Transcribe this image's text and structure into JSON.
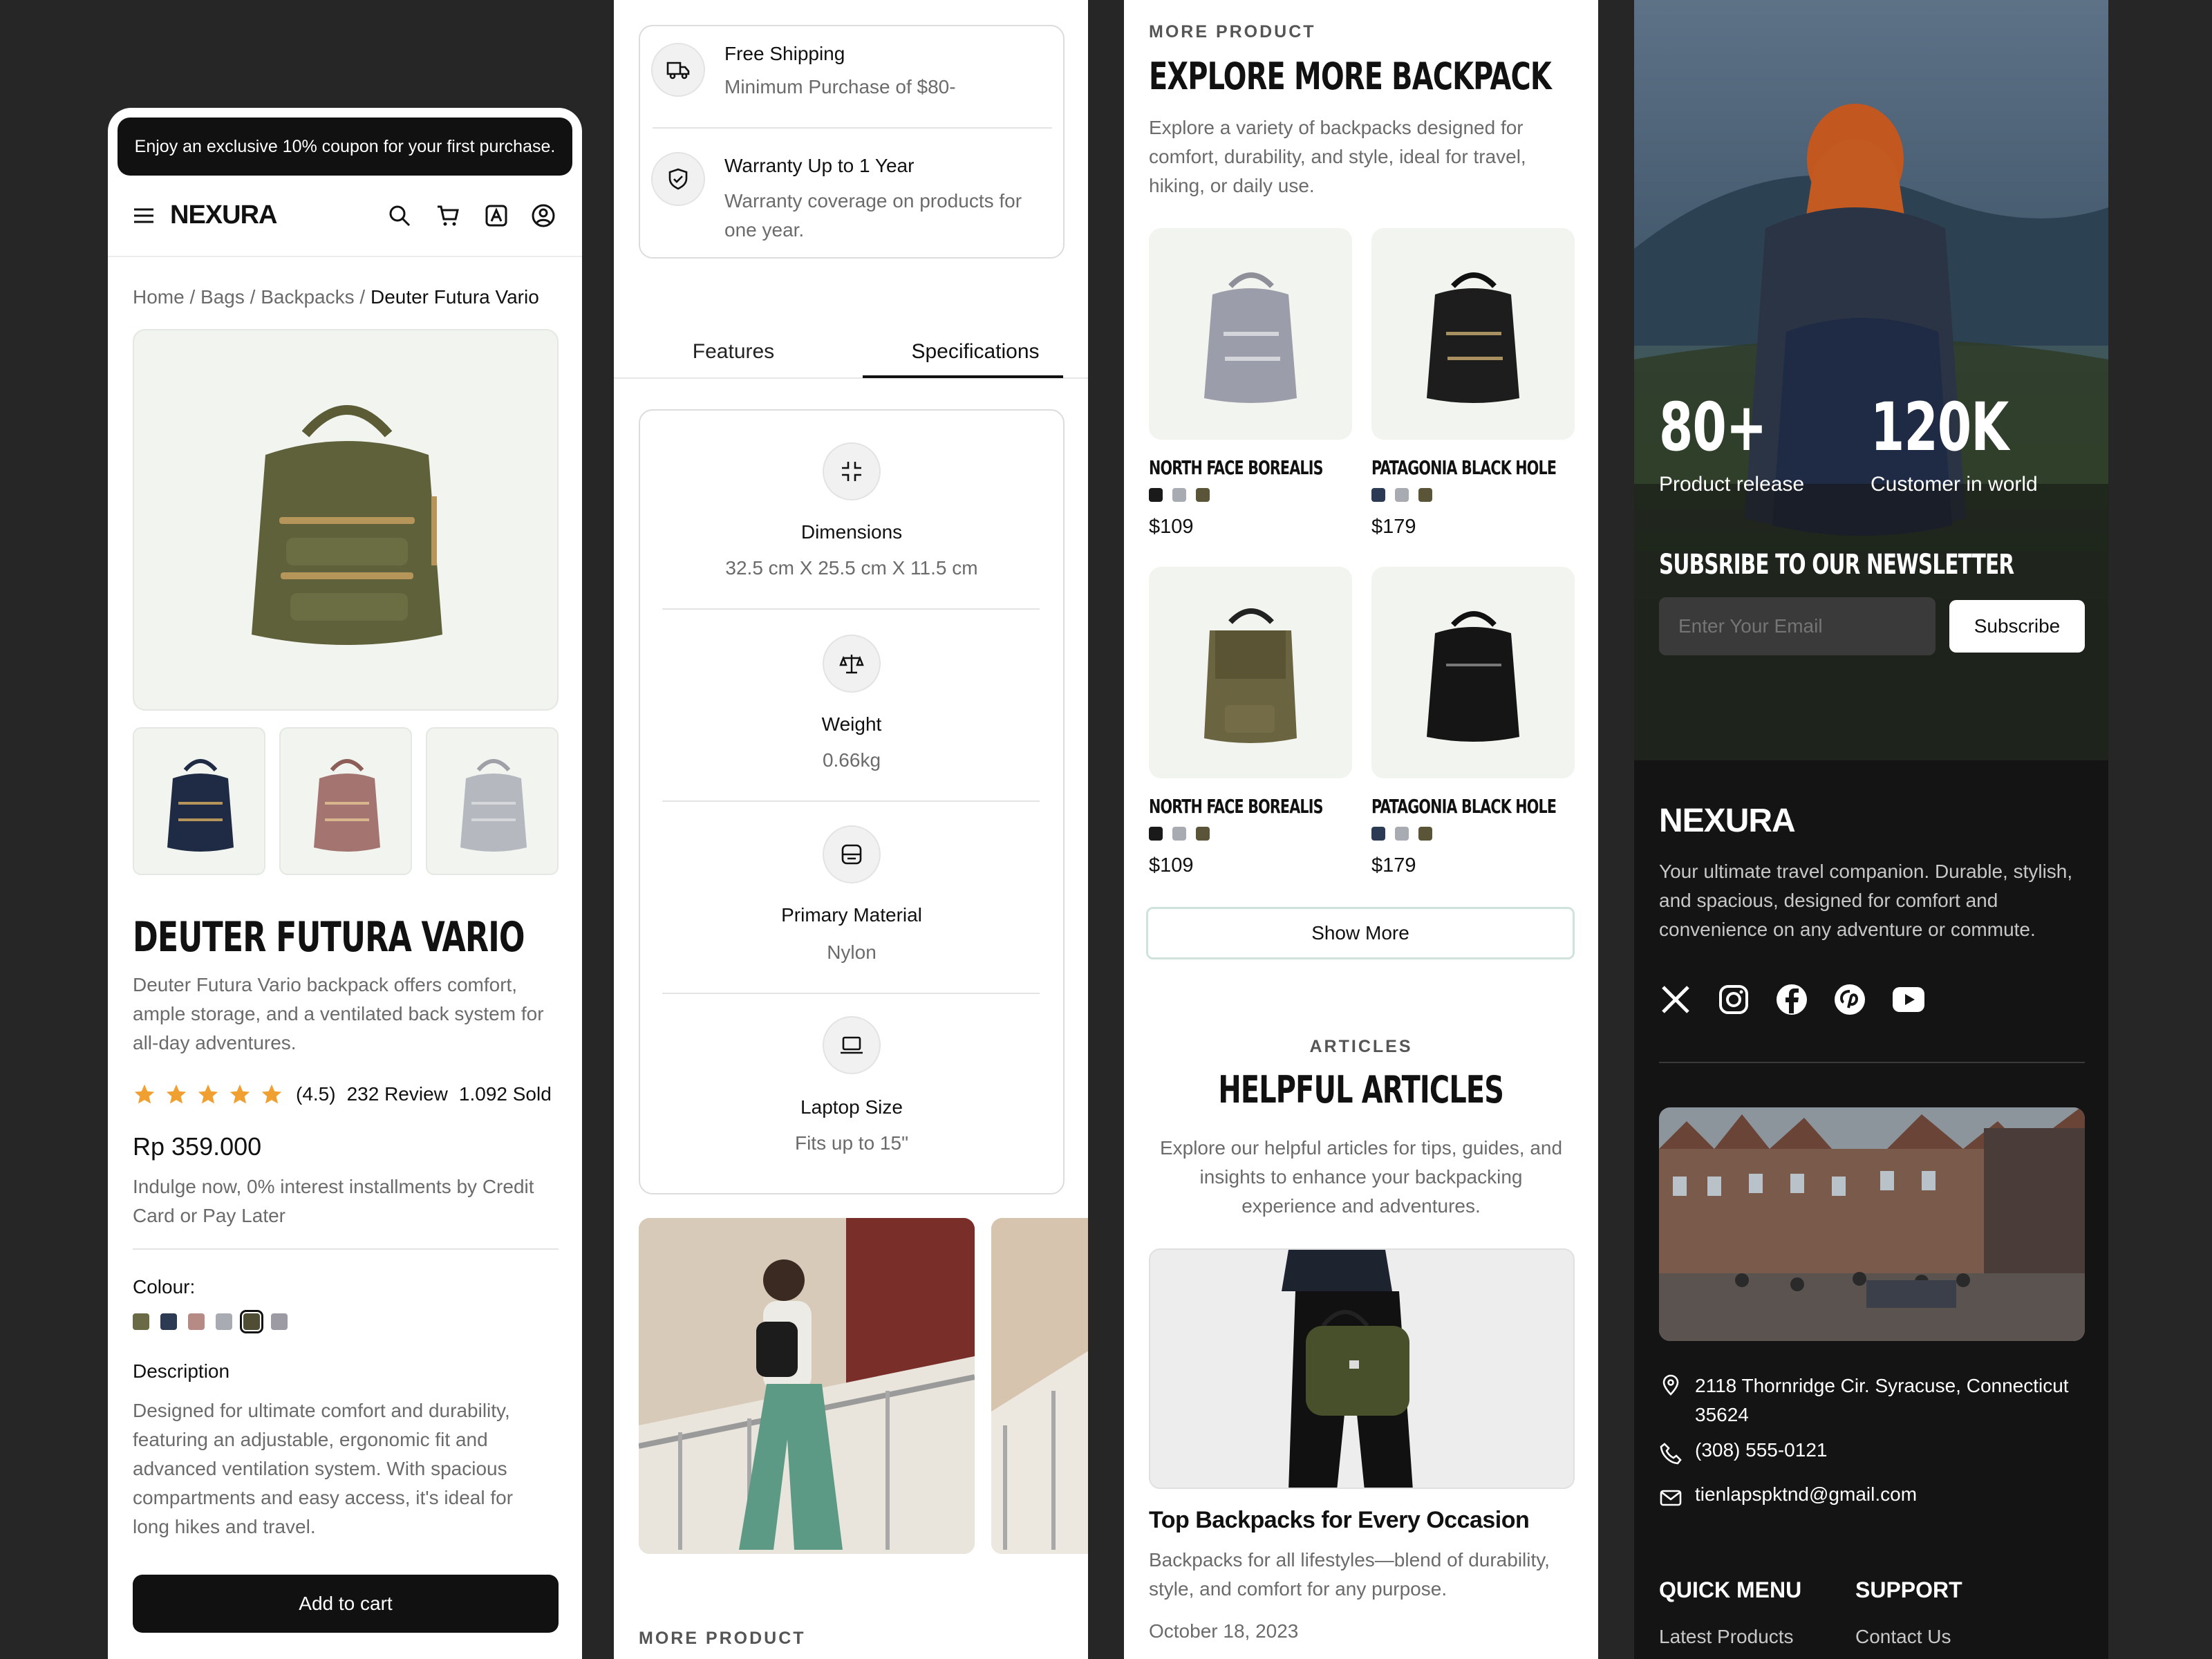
{
  "promo_banner": {
    "text": "Enjoy an exclusive 10% coupon for your first purchase."
  },
  "header": {
    "brand": "NEXURA"
  },
  "breadcrumb": {
    "items": [
      "Home",
      "Bags",
      "Backpacks"
    ],
    "current": "Deuter Futura Vario"
  },
  "product": {
    "title": "DEUTER FUTURA VARIO",
    "summary": "Deuter Futura Vario backpack offers comfort, ample storage, and a ventilated back system for all-day adventures.",
    "rating": "(4.5)",
    "reviews": "232 Review",
    "sold": "1.092 Sold",
    "price": "Rp 359.000",
    "installment": "Indulge now, 0% interest installments by Credit Card or Pay Later",
    "colour_label": "Colour:",
    "colours": [
      "#6b6a47",
      "#2d3a53",
      "#b68a85",
      "#a8abb1",
      "#4f4d34",
      "#9c9aa3"
    ],
    "description_label": "Description",
    "description": "Designed for ultimate comfort and durability, featuring an adjustable, ergonomic fit and advanced ventilation system. With spacious compartments and easy access, it's ideal for long hikes and travel.",
    "add_to_cart": "Add to cart"
  },
  "perks": [
    {
      "title": "Free Shipping",
      "subtitle": "Minimum Purchase of $80-",
      "icon": "truck-icon"
    },
    {
      "title": "Warranty Up to 1 Year",
      "subtitle": "Warranty coverage on products for one year.",
      "icon": "shield-check-icon"
    }
  ],
  "tabs": {
    "features": "Features",
    "specifications": "Specifications",
    "active": "Specifications"
  },
  "specs": [
    {
      "label": "Dimensions",
      "value": "32.5 cm X 25.5 cm X 11.5 cm",
      "icon": "minimize-icon"
    },
    {
      "label": "Weight",
      "value": "0.66kg",
      "icon": "scale-icon"
    },
    {
      "label": "Primary Material",
      "value": "Nylon",
      "icon": "material-icon"
    },
    {
      "label": "Laptop Size",
      "value": "Fits up to 15\"",
      "icon": "laptop-icon"
    }
  ],
  "more_product": {
    "eyebrow": "MORE PRODUCT",
    "title": "EXPLORE MORE BACKPACK",
    "description": "Explore a variety of backpacks designed for comfort, durability, and style, ideal for travel, hiking, or daily use.",
    "items": [
      {
        "name": "NORTH FACE BOREALIS",
        "price": "$109",
        "colours": [
          "#1a1a1a",
          "#a8abb1",
          "#5a5538"
        ]
      },
      {
        "name": "PATAGONIA BLACK HOLE",
        "price": "$179",
        "colours": [
          "#2d3a53",
          "#a8abb1",
          "#5a5538"
        ]
      },
      {
        "name": "NORTH FACE BOREALIS",
        "price": "$109",
        "colours": [
          "#1a1a1a",
          "#a8abb1",
          "#5a5538"
        ]
      },
      {
        "name": "PATAGONIA BLACK HOLE",
        "price": "$179",
        "colours": [
          "#2d3a53",
          "#a8abb1",
          "#5a5538"
        ]
      }
    ],
    "show_more": "Show More"
  },
  "articles": {
    "eyebrow": "ARTICLES",
    "title": "HELPFUL ARTICLES",
    "description": "Explore our helpful articles for tips, guides, and insights to enhance your backpacking experience and adventures.",
    "featured": {
      "title": "Top Backpacks for Every Occasion",
      "excerpt": "Backpacks for all lifestyles—blend of durability, style, and comfort for any purpose.",
      "date": "October 18, 2023"
    }
  },
  "stats": [
    {
      "value": "80+",
      "label": "Product release"
    },
    {
      "value": "120K",
      "label": "Customer in world"
    }
  ],
  "newsletter": {
    "title": "SUBSRIBE TO OUR NEWSLETTER",
    "placeholder": "Enter Your Email",
    "button": "Subscribe"
  },
  "footer": {
    "brand": "NEXURA",
    "tagline": "Your ultimate travel companion. Durable, stylish, and spacious, designed for comfort and convenience on any adventure or commute.",
    "address": "2118 Thornridge Cir. Syracuse, Connecticut 35624",
    "phone": "(308) 555-0121",
    "email": "tienlapspktnd@gmail.com",
    "quick_menu": {
      "title": "QUICK MENU",
      "items": [
        "Latest Products"
      ]
    },
    "support": {
      "title": "SUPPORT",
      "items": [
        "Contact Us"
      ]
    }
  },
  "colors": {
    "accent_star": "#f0a030",
    "product_bg": "#f1f4ef",
    "dark": "#111111"
  }
}
